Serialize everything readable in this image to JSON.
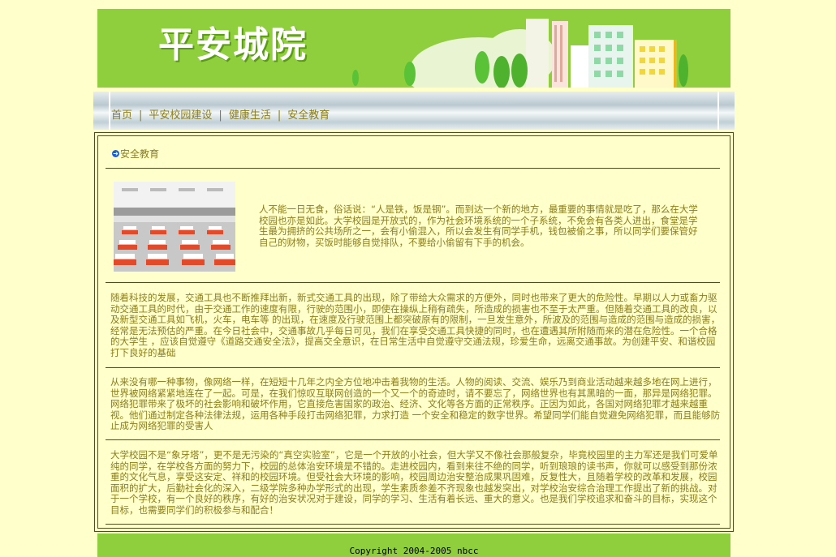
{
  "banner": {
    "logo_text": "平安城院"
  },
  "nav": {
    "items": [
      "首页",
      "平安校园建设",
      "健康生活",
      "安全教育"
    ],
    "separator": "|"
  },
  "section": {
    "title": "安全教育",
    "arrow_icon": "circle-arrow-icon"
  },
  "article": {
    "intro": "人不能一日无食，俗话说：“人是铁，饭是钢”。而到达一个新的地方，最重要的事情就是吃了，那么在大学校园也亦是如此。大学校园是开放式的，作为社会环境系统的一个子系统，不免会有各类人进出，食堂是学生最为拥挤的公共场所之一，会有小偷混入，所以会发生有同学手机，钱包被偷之事，所以同学们要保管好自己的财物，买饭时能够自觉排队，不要给小偷留有下手的机会。",
    "p2": "随着科技的发展，交通工具也不断推拜出新，新式交通工具的出现，除了带给大众需求的方便外，同时也带来了更大的危险性。早期以人力或畜力驱动交通工具的时代，由于交通工作的速度有限，行驶的范围小，即使在操纵上稍有疏失，所造成的损害也不至于太严重。但随着交通工具的改良，以及新型交通工具如飞机，火车，电车等 的出现，在速度及行驶范围上都突破原有的限制，一旦发生意外，所波及的范围与造成的范围与造成的损害，经常是无法预估的严重。在今日社会中，交通事故几乎每日可见，我们在享受交通工具快捷的同时，也在遭遇其所附随而来的潜在危险性。一个合格的大学生 ，应该自觉遵守《道路交通安全法》，提高交全意识，在日常生活中自觉遵守交通法规，珍爱生命，远离交通事故。为创建平安、和谐校园打下良好的基础",
    "p3": "从来没有哪一种事物，像网络一样，在短短十几年之内全方位地冲击着我物的生活。人物的阅读、交流、娱乐乃到商业活动越来越多地在网上进行，世界被网络紧紧地连在了一起。可是，在我们惊叹互联网创造的一个又一个的奇迹时，请不要忘了，网络世界也有其黑暗的一面，那异是网络犯罪。网络犯罪带来了极坏的社会影响和破坏作用，它直接危害国家的政治、经济、文化等各方面的正常秩序。正因为如此，各国对网络犯罪才越来越重视。他们通过制定各种法律法规，运用各种手段打击网络犯罪，力求打造 一个安全和稳定的数字世界。希望同学们能自觉避免网络犯罪，而且能够防止成为网络犯罪的受害人",
    "p4": "大学校园不是“象牙塔”，更不是无污染的“真空实验室”，它是一个开放的小社会，但大学又不像社会那般复杂，毕竟校园里的主力军还是我们可爱单纯的同学，在学校各方面的努力下，校园的总体治安环境是不错的。走进校园内，看到来往不绝的同学，听到琅琅的读书声，你就可以感受到那份浓重的文化气息，享受这安定、祥和的校园环境。但受社会大环境的影响，校园周边治安整治成果巩固难，反复性大，且随着学校的改革和发展，校园面积的扩大，后勤社会化的深入，二级学院多种办学形式的出现，学生素质参差不齐现象也越发突出，对学校治安综合治理工作提出了新的挑战。对于一个学校，有一个良好的秩序，有好的治安状况对于建设，同学的学习、生活有着长远、重大的意义。也是我们学校追求和奋斗的目标，实现这个目标，也需要同学们的积极参与和配合！"
  },
  "footer": {
    "copyright": "Copyright 2004-2005 nbcc"
  },
  "colors": {
    "banner": "#8fce3c",
    "page_bg": "#ffffcc",
    "text": "#8b7d1a"
  }
}
